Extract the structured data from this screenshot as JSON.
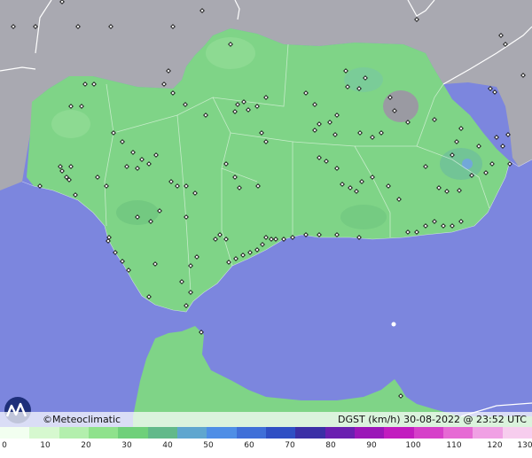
{
  "credit": "©Meteoclimatic",
  "title": "DGST (km/h)  30-08-2022 @ 23:52 UTC",
  "colors": {
    "sea": "#7c86de",
    "land_region": "#7fd487",
    "land_other": "#a9a9b1",
    "border": "#ffffff",
    "station": "#111111"
  },
  "scale": {
    "labels": [
      "0",
      "10",
      "20",
      "30",
      "40",
      "50",
      "60",
      "70",
      "80",
      "90",
      "100",
      "110",
      "120",
      "130"
    ],
    "colors": [
      "#f2fff0",
      "#d6f8cf",
      "#b3efad",
      "#8fe28c",
      "#6fd07a",
      "#62b98a",
      "#5fa6cf",
      "#4e8ee6",
      "#3f6fd8",
      "#2f4fc4",
      "#3b2fa6",
      "#6a1fb0",
      "#9b16b8",
      "#c21cbf",
      "#d640c9",
      "#e66ad4",
      "#f0a0e4",
      "#f7cdee"
    ]
  },
  "features": {
    "mountain_patches": [
      {
        "name": "sierra-nevada"
      }
    ]
  }
}
